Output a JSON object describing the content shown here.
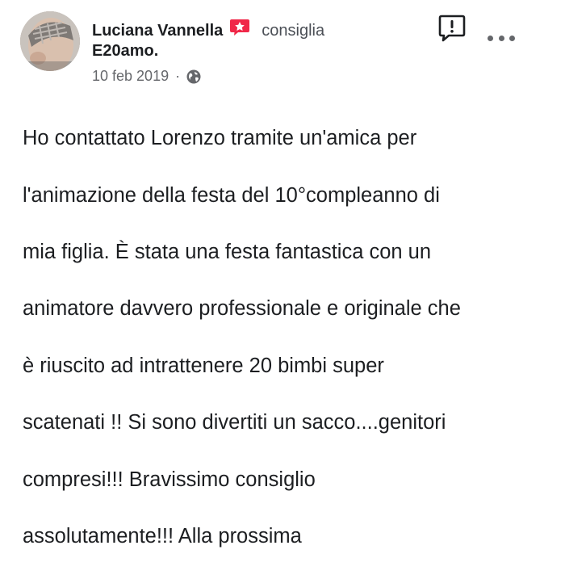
{
  "post": {
    "author": "Luciana Vannella",
    "verb": "consiglia",
    "page_name": "E20amo.",
    "date": "10 feb 2019",
    "separator": "·",
    "privacy_icon": "globe-icon",
    "recommend_icon": "recommend-badge-icon",
    "report_icon": "report-icon",
    "more_icon": "more-options-icon",
    "accent_color": "#f02849",
    "body_lines": [
      "Ho contattato Lorenzo tramite un'amica per",
      "l'animazione della festa del 10°compleanno di",
      "mia figlia. È stata una festa fantastica con un",
      "animatore davvero professionale e originale che",
      "è riuscito ad intrattenere 20 bimbi super",
      "scatenati !! Si sono divertiti un sacco....genitori",
      "compresi!!! Bravissimo consiglio",
      "assolutamente!!! Alla prossima"
    ]
  }
}
